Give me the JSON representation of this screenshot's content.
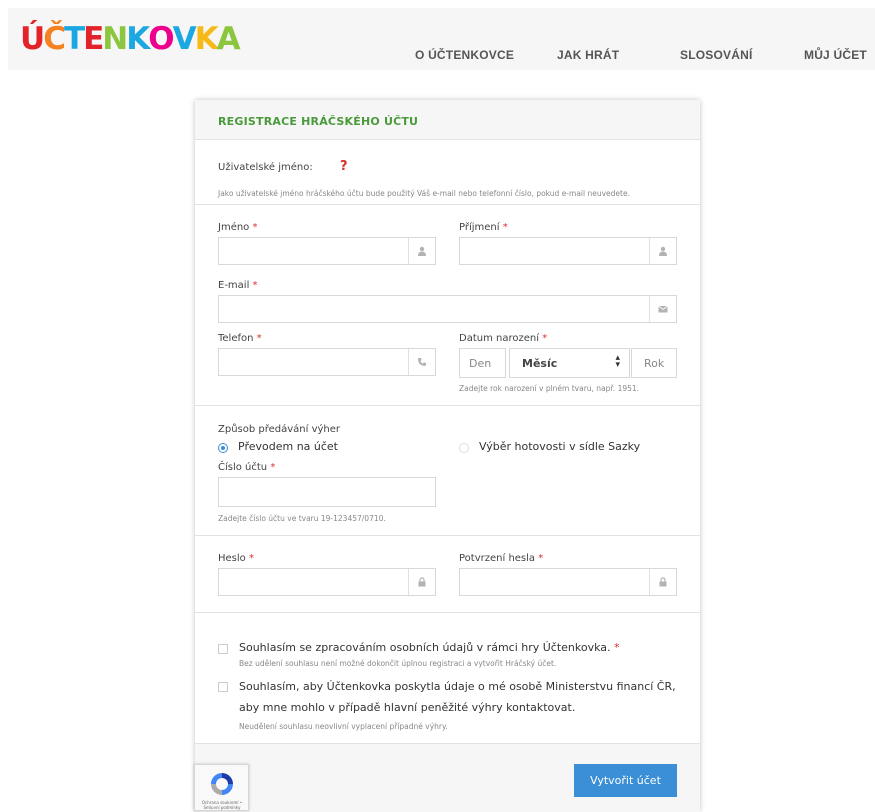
{
  "header": {
    "logo_letters": [
      {
        "ch": "Ú",
        "color": "#e2232a"
      },
      {
        "ch": "Č",
        "color": "#f58220"
      },
      {
        "ch": "T",
        "color": "#1ba7e1"
      },
      {
        "ch": "E",
        "color": "#e2232a"
      },
      {
        "ch": "N",
        "color": "#8cc63f"
      },
      {
        "ch": "K",
        "color": "#1ba7e1"
      },
      {
        "ch": "O",
        "color": "#ec008c"
      },
      {
        "ch": "V",
        "color": "#1ba7e1"
      },
      {
        "ch": "K",
        "color": "#f7b918"
      },
      {
        "ch": "A",
        "color": "#8cc63f"
      }
    ],
    "nav": [
      "O ÚČTENKOVCE",
      "JAK HRÁT",
      "SLOSOVÁNÍ",
      "MŮJ ÚČET"
    ]
  },
  "form": {
    "title": "REGISTRACE HRÁČSKÉHO ÚČTU",
    "username_label": "Uživatelské jméno:",
    "username_help_icon": "?",
    "username_help": "Jako uživatelské jméno hráčského účtu bude použitý Váš e-mail nebo telefonní číslo, pokud e-mail neuvedete.",
    "required_mark": "*",
    "first_name_label": "Jméno",
    "last_name_label": "Příjmení",
    "email_label": "E-mail",
    "phone_label": "Telefon",
    "dob_label": "Datum narození",
    "dob_day_placeholder": "Den",
    "dob_month_value": "Měsíc",
    "dob_year_placeholder": "Rok",
    "dob_help": "Zadejte rok narození v plném tvaru, např. 1951.",
    "payout_label": "Způsob předávání výher",
    "payout_option_transfer": "Převodem na účet",
    "payout_option_cash": "Výběr hotovosti v sídle Sazky",
    "account_label": "Číslo účtu",
    "account_help": "Zadejte číslo účtu ve tvaru 19-123457/0710.",
    "password_label": "Heslo",
    "password_confirm_label": "Potvrzení hesla",
    "consent1": "Souhlasím se zpracováním osobních údajů v rámci hry Účtenkovka.",
    "consent1_help": "Bez udělení souhlasu není možné dokončit úplnou registraci a vytvořit Hráčský účet.",
    "consent2_line1": "Souhlasím, aby Účtenkovka poskytla údaje o mé osobě Ministerstvu financí ČR,",
    "consent2_line2": "aby mne mohlo v případě hlavní peněžité výhry kontaktovat.",
    "consent2_help": "Neudělení souhlasu neovlivní vyplacení případné výhry.",
    "submit_label": "Vytvořit účet",
    "captcha_text": "Ochrana soukromí • Smluvní podmínky",
    "accent_color": "#4a9a3b",
    "button_color": "#3a8fd6"
  }
}
